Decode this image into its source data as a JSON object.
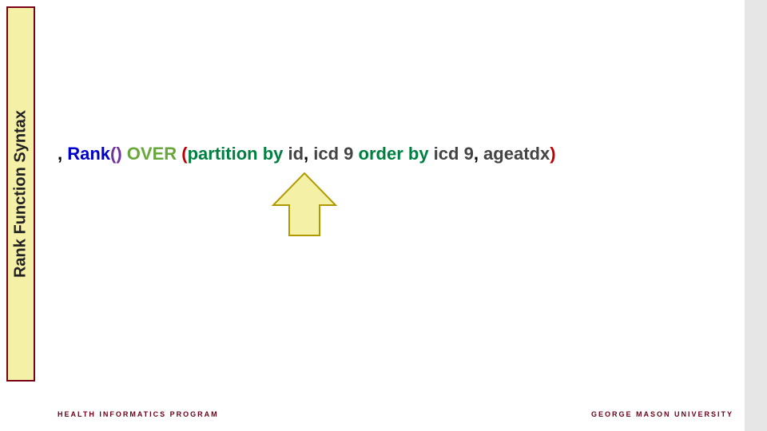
{
  "sidebar": {
    "title": "Rank Function Syntax"
  },
  "code": {
    "lead": ", ",
    "rank": "Rank",
    "paren_open1": "(",
    "paren_close1": ")",
    "over": " OVER ",
    "paren_open2": "(",
    "partition_by": "partition by ",
    "id": "id",
    "comma1": ", ",
    "icd9_a": "icd 9",
    "order_by": " order by ",
    "icd9_b": "icd 9",
    "comma2": ", ",
    "ageatdx": "ageatdx",
    "paren_close2": ")"
  },
  "footer": {
    "left": "HEALTH INFORMATICS PROGRAM",
    "right": "GEORGE MASON UNIVERSITY"
  },
  "icons": {
    "arrow": "up-arrow-icon"
  }
}
